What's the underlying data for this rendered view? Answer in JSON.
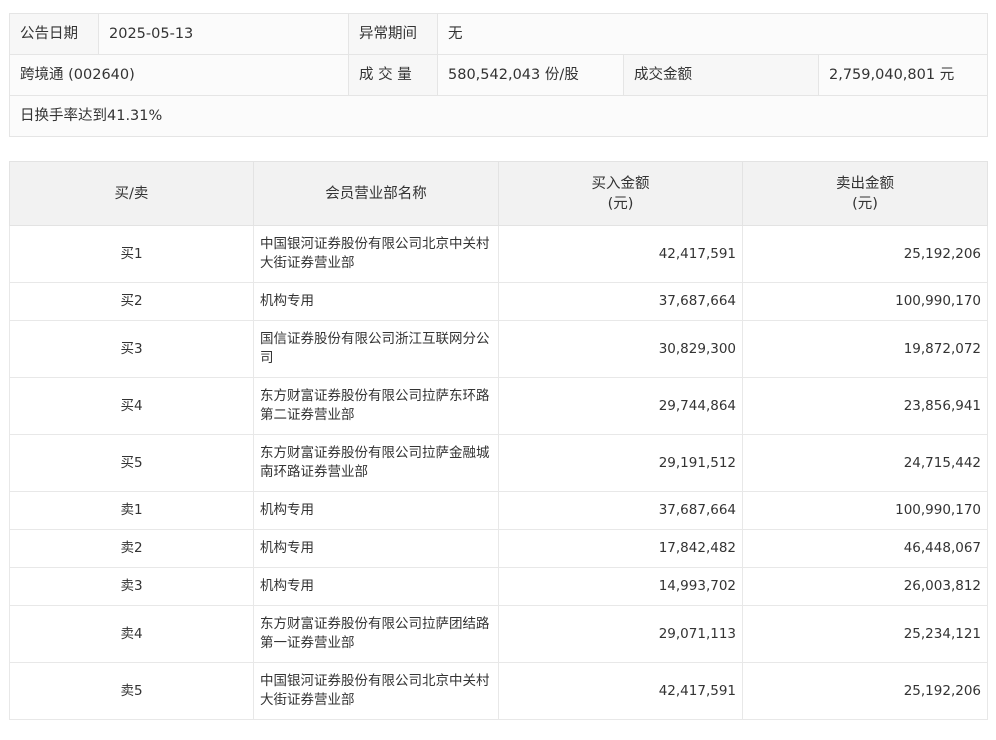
{
  "info": {
    "announce_date_label": "公告日期",
    "announce_date_value": "2025-05-13",
    "abnormal_period_label": "异常期间",
    "abnormal_period_value": "无",
    "stock_name": "跨境通 (002640)",
    "volume_label": "成 交 量",
    "volume_value": "580,542,043 份/股",
    "turnover_label": "成交金额",
    "turnover_value": "2,759,040,801 元",
    "reason": "日换手率达到41.31%"
  },
  "table": {
    "headers": {
      "side": "买/卖",
      "branch": "会员营业部名称",
      "buy_line1": "买入金额",
      "buy_line2": "(元)",
      "sell_line1": "卖出金额",
      "sell_line2": "(元)"
    },
    "rows": [
      {
        "side": "买1",
        "branch": "中国银河证券股份有限公司北京中关村大街证券营业部",
        "buy": "42,417,591",
        "sell": "25,192,206"
      },
      {
        "side": "买2",
        "branch": "机构专用",
        "buy": "37,687,664",
        "sell": "100,990,170"
      },
      {
        "side": "买3",
        "branch": "国信证券股份有限公司浙江互联网分公司",
        "buy": "30,829,300",
        "sell": "19,872,072"
      },
      {
        "side": "买4",
        "branch": "东方财富证券股份有限公司拉萨东环路第二证券营业部",
        "buy": "29,744,864",
        "sell": "23,856,941"
      },
      {
        "side": "买5",
        "branch": "东方财富证券股份有限公司拉萨金融城南环路证券营业部",
        "buy": "29,191,512",
        "sell": "24,715,442"
      },
      {
        "side": "卖1",
        "branch": "机构专用",
        "buy": "37,687,664",
        "sell": "100,990,170"
      },
      {
        "side": "卖2",
        "branch": "机构专用",
        "buy": "17,842,482",
        "sell": "46,448,067"
      },
      {
        "side": "卖3",
        "branch": "机构专用",
        "buy": "14,993,702",
        "sell": "26,003,812"
      },
      {
        "side": "卖4",
        "branch": "东方财富证券股份有限公司拉萨团结路第一证券营业部",
        "buy": "29,071,113",
        "sell": "25,234,121"
      },
      {
        "side": "卖5",
        "branch": "中国银河证券股份有限公司北京中关村大街证券营业部",
        "buy": "42,417,591",
        "sell": "25,192,206"
      }
    ]
  }
}
